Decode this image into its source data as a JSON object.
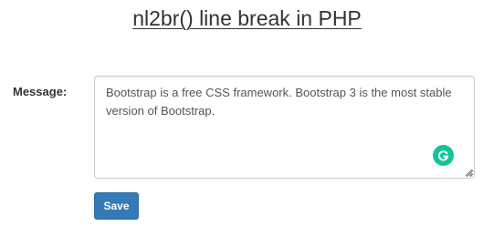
{
  "page": {
    "title": "nl2br() line break in PHP"
  },
  "form": {
    "message_label": "Message:",
    "message_value": "Bootstrap is a free CSS framework. Bootstrap 3 is the most stable version of Bootstrap.",
    "save_label": "Save"
  },
  "icons": {
    "grammarly": "grammarly-icon",
    "resize": "resize-grip-icon"
  },
  "colors": {
    "button_primary": "#337ab7",
    "grammarly_green": "#15c39a",
    "border": "#cccccc"
  }
}
